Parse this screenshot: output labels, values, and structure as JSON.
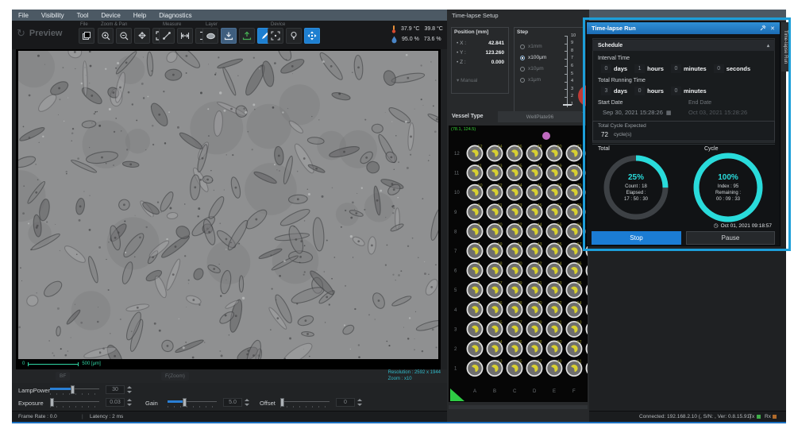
{
  "menu": {
    "items": [
      "File",
      "Visibility",
      "Tool",
      "Device",
      "Help",
      "Diagnostics"
    ]
  },
  "toolbar": {
    "preview": "Preview",
    "groups": {
      "file": "File",
      "zoom_pan": "Zoom & Pan",
      "measure": "Measure",
      "layer": "Layer",
      "device": "Device"
    },
    "env": {
      "temp_left": "37.9 °C",
      "temp_right": "39.8 °C",
      "hum_left": "95.0 %",
      "hum_right": "73.6 %"
    }
  },
  "viewport": {
    "scale_zero": "0",
    "scale_label": "500 [μm]",
    "channel_tabs": [
      "BF",
      "F(Zoom)"
    ],
    "resolution": "Resolution : 2592 x 1944",
    "zoom": "Zoom : x10"
  },
  "controls": {
    "lamp": {
      "label": "LampPower",
      "value": "30"
    },
    "exposure": {
      "label": "Exposure",
      "value": "0.03"
    },
    "gain": {
      "label": "Gain",
      "value": "5.0"
    },
    "offset": {
      "label": "Offset",
      "value": "0"
    }
  },
  "statusbar": {
    "frame_rate": "Frame Rate : 0.0",
    "latency": "Latency : 2 ms",
    "connection": "Connected: 192.168.2.10 (, S/N: , Ver: 0.8.15.91)",
    "tx": "Tx",
    "rx": "Rx"
  },
  "setup_panel": {
    "title": "Time-lapse Setup",
    "position": {
      "label": "Position [mm]",
      "x_label": "• X :",
      "x": "42.841",
      "y_label": "• Y :",
      "y": "123.260",
      "z_label": "• Z :",
      "z": "0.000",
      "mode": "▾ Manual"
    },
    "step": {
      "label": "Step",
      "options": [
        {
          "label": "x1mm",
          "selected": false
        },
        {
          "label": "x100μm",
          "selected": true
        },
        {
          "label": "x10μm",
          "selected": false
        },
        {
          "label": "x1μm",
          "selected": false
        }
      ],
      "scale_ticks": [
        "10",
        "9",
        "8",
        "7",
        "6",
        "5",
        "4",
        "3",
        "2",
        "1"
      ]
    },
    "vessel": {
      "label": "Vessel Type",
      "type": "WellPlate96",
      "coords": "(78.1, 124.5)",
      "row_labels": [
        "12",
        "11",
        "10",
        "9",
        "8",
        "7",
        "6",
        "5",
        "4",
        "3",
        "2",
        "1"
      ],
      "col_labels": [
        "A",
        "B",
        "C",
        "D",
        "E",
        "F"
      ]
    }
  },
  "run_panel": {
    "title": "Time-lapse Run",
    "schedule": "Schedule",
    "interval": {
      "label": "Interval Time",
      "fields": [
        {
          "value": "0",
          "unit": "days"
        },
        {
          "value": "1",
          "unit": "hours"
        },
        {
          "value": "0",
          "unit": "minutes"
        },
        {
          "value": "0",
          "unit": "seconds"
        }
      ]
    },
    "total_running": {
      "label": "Total Running Time",
      "fields": [
        {
          "value": "3",
          "unit": "days"
        },
        {
          "value": "0",
          "unit": "hours"
        },
        {
          "value": "0",
          "unit": "minutes"
        }
      ]
    },
    "start_date": {
      "label": "Start Date",
      "value": "Sep 30, 2021 15:28:26"
    },
    "end_date": {
      "label": "End Date",
      "value": "Oct 03, 2021 15:28:26"
    },
    "total_cycle": {
      "label": "Total Cycle Expected",
      "value": "72",
      "unit": "cycle(s)"
    },
    "rings": {
      "total": {
        "label": "Total",
        "percent": 25,
        "percent_label": "25%",
        "line1": "Count : 18",
        "line2": "Elapsed :",
        "line3": "17 : 50 : 30"
      },
      "cycle": {
        "label": "Cycle",
        "percent": 100,
        "percent_label": "100%",
        "line1": "Index : 95",
        "line2": "Remaining :",
        "line3": "00 : 09 : 33"
      }
    },
    "timestamp": "Oct 01, 2021 09:18:57",
    "buttons": {
      "stop": "Stop",
      "pause": "Pause"
    },
    "side_tab": "Time-lapse Run"
  },
  "colors": {
    "accent_blue": "#1e7fd0",
    "progress_cyan": "#29dbdb",
    "ring_track": "#3d4145",
    "annotation_blue": "#1c9ed9",
    "well_yellow": "#d8d031",
    "coords_green": "#35d435"
  }
}
